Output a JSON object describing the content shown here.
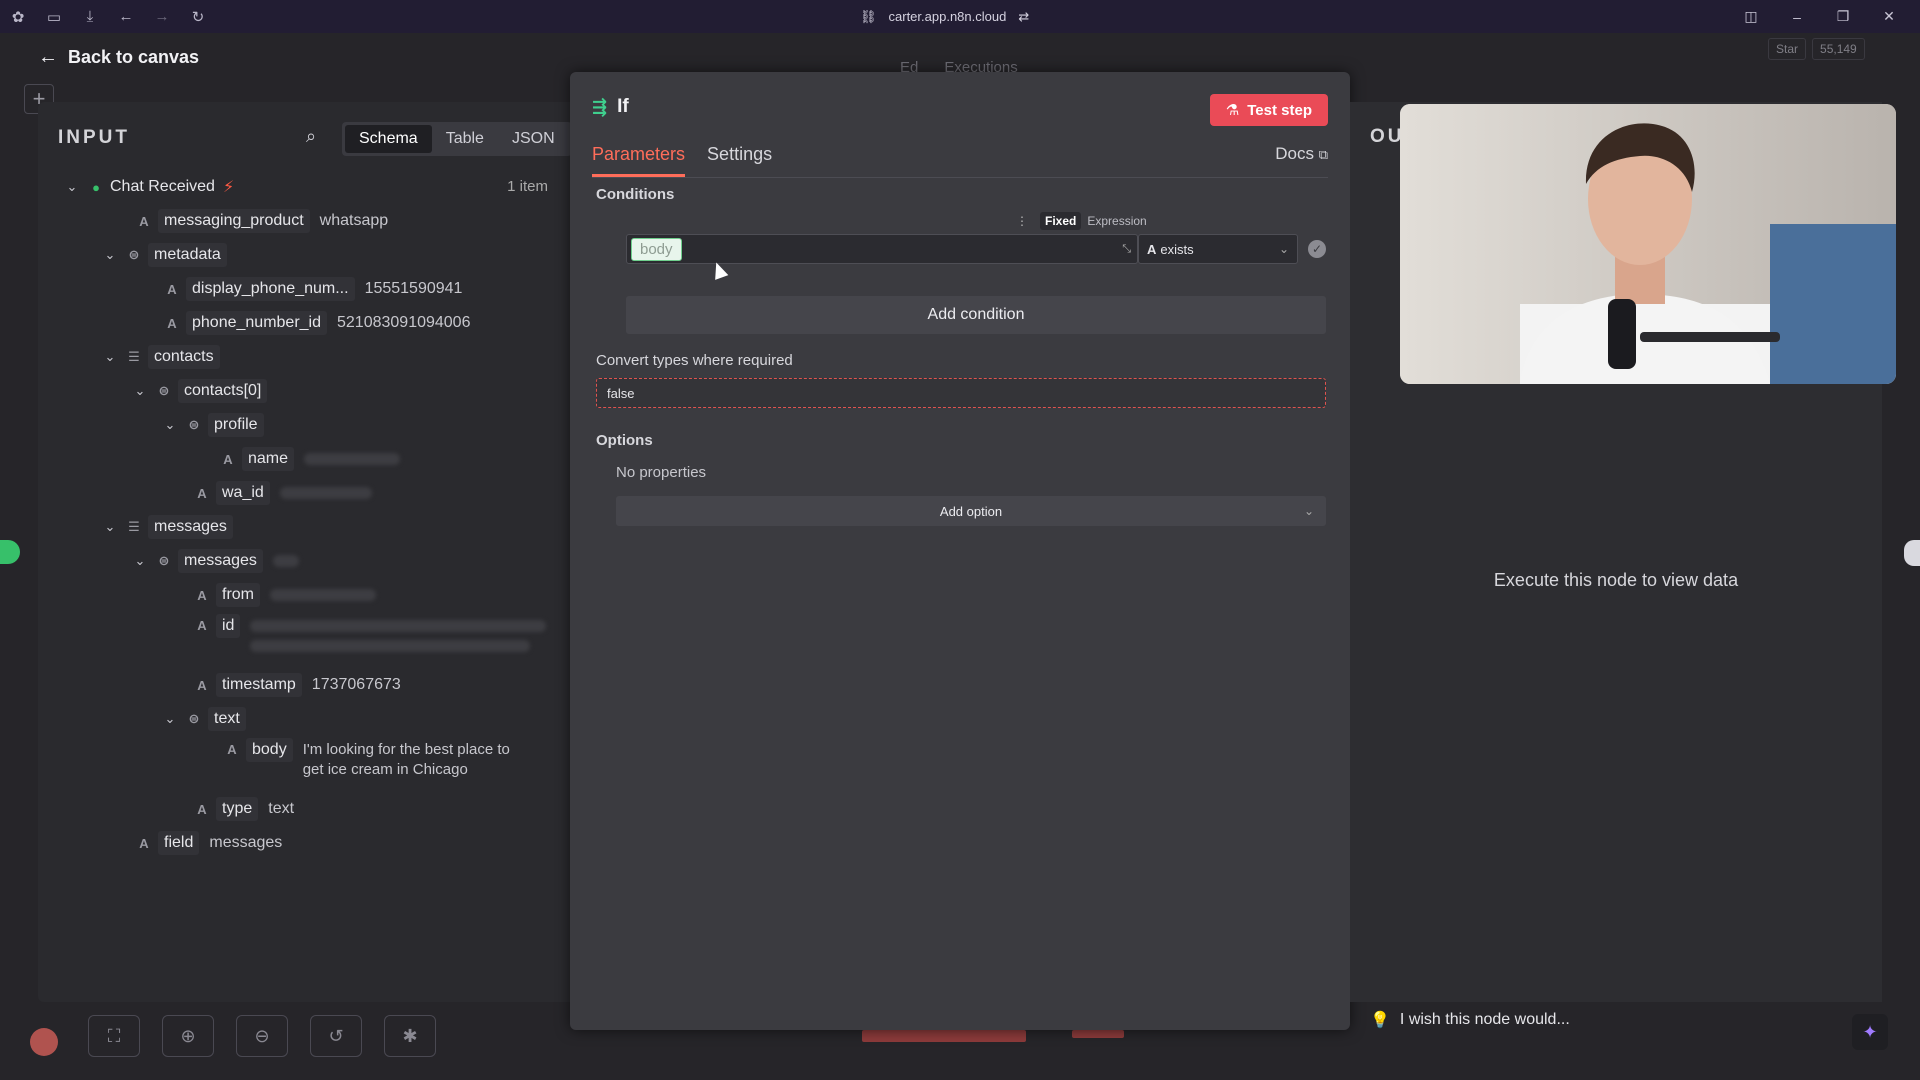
{
  "browser": {
    "url": "carter.app.n8n.cloud"
  },
  "canvas": {
    "back_label": "Back to canvas",
    "top_tabs": [
      "Ed",
      "Executions"
    ],
    "star_label": "Star",
    "star_count": "55,149"
  },
  "input": {
    "title": "INPUT",
    "view_tabs": [
      "Schema",
      "Table",
      "JSON"
    ],
    "active_view": "Schema",
    "root_label": "Chat Received",
    "item_count": "1 item",
    "fields": {
      "messaging_product": {
        "key": "messaging_product",
        "value": "whatsapp"
      },
      "metadata": {
        "key": "metadata"
      },
      "display_phone": {
        "key": "display_phone_num...",
        "value": "15551590941"
      },
      "phone_number_id": {
        "key": "phone_number_id",
        "value": "521083091094006"
      },
      "contacts": {
        "key": "contacts"
      },
      "contacts0": {
        "key": "contacts[0]"
      },
      "profile": {
        "key": "profile"
      },
      "name": {
        "key": "name"
      },
      "wa_id": {
        "key": "wa_id"
      },
      "messages": {
        "key": "messages"
      },
      "messages0": {
        "key": "messages"
      },
      "from": {
        "key": "from"
      },
      "id": {
        "key": "id"
      },
      "timestamp": {
        "key": "timestamp",
        "value": "1737067673"
      },
      "text": {
        "key": "text"
      },
      "body": {
        "key": "body",
        "value_line1": "I'm looking for the best place to",
        "value_line2": "get ice cream in Chicago"
      },
      "type": {
        "key": "type",
        "value": "text"
      },
      "field": {
        "key": "field",
        "value": "messages"
      }
    }
  },
  "node": {
    "title": "If",
    "test_button": "Test step",
    "tabs": [
      "Parameters",
      "Settings"
    ],
    "active_tab": "Parameters",
    "docs_label": "Docs",
    "conditions_label": "Conditions",
    "mode_fixed": "Fixed",
    "mode_expression": "Expression",
    "condition_value": "body",
    "operator": "exists",
    "add_condition": "Add condition",
    "convert_label": "Convert types where required",
    "convert_value": "false",
    "options_label": "Options",
    "no_properties": "No properties",
    "add_option": "Add option"
  },
  "output": {
    "title": "OU",
    "empty_message": "Execute this node to view data",
    "wish_text": "I wish this node would..."
  },
  "colors": {
    "accent": "#ff6d5a",
    "test_button": "#ea4b57",
    "success": "#3fcf8e"
  }
}
